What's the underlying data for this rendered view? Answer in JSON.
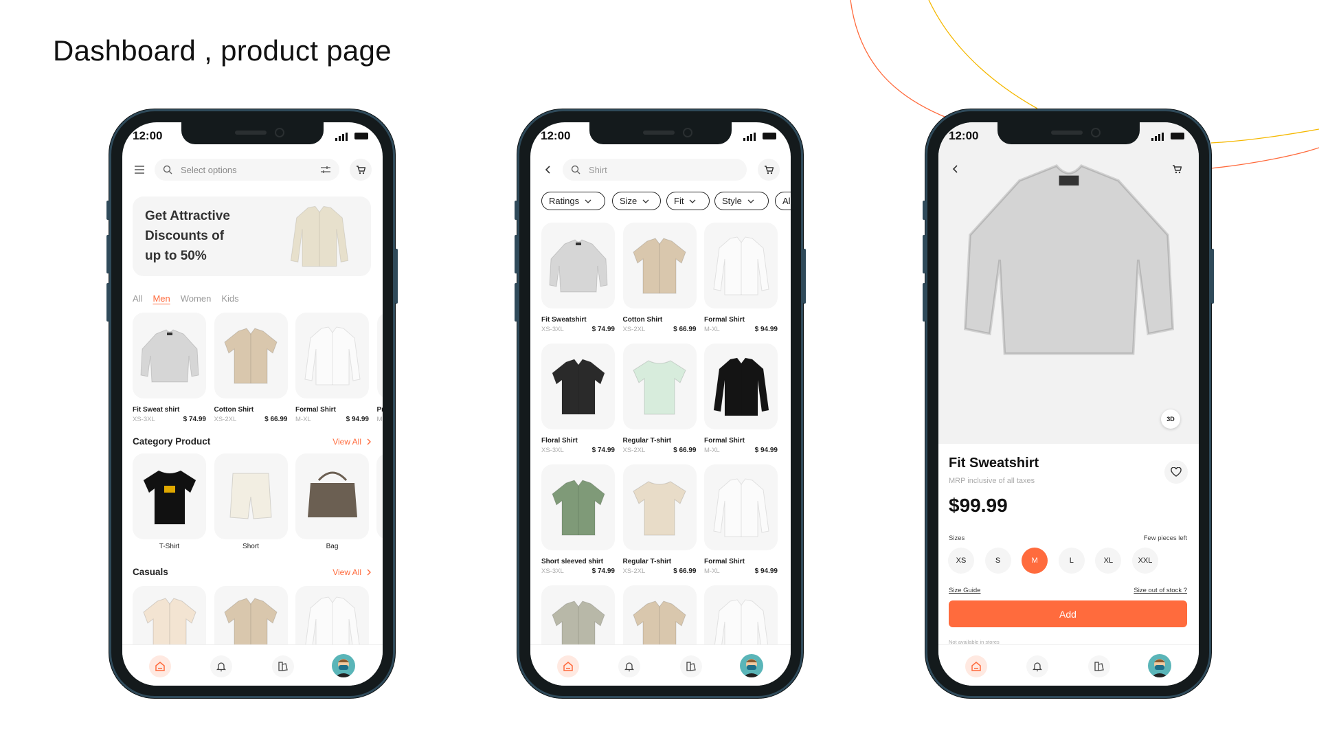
{
  "page_title": "Dashboard , product page",
  "accent": "#ff6b3d",
  "status_time": "12:00",
  "dashboard": {
    "search_placeholder": "Select options",
    "banner": [
      "Get Attractive",
      "Discounts of",
      "up to 50%"
    ],
    "tabs": [
      {
        "label": "All"
      },
      {
        "label": "Men",
        "active": true
      },
      {
        "label": "Women"
      },
      {
        "label": "Kids"
      }
    ],
    "products": [
      {
        "name": "Fit Sweat shirt",
        "sizes": "XS-3XL",
        "price": "$ 74.99",
        "image": "sweatshirt",
        "color": "#d6d6d6"
      },
      {
        "name": "Cotton Shirt",
        "sizes": "XS-2XL",
        "price": "$ 66.99",
        "image": "shirt",
        "color": "#d9c7ad"
      },
      {
        "name": "Formal Shirt",
        "sizes": "M-XL",
        "price": "$ 94.99",
        "image": "longshirt",
        "color": "#fbfbfb"
      },
      {
        "name": "Pr",
        "sizes": "M",
        "price": "",
        "image": "none",
        "color": "#f6f6f6"
      }
    ],
    "category_title": "Category Product",
    "view_all": "View All",
    "categories": [
      {
        "label": "T-Shirt",
        "image": "tshirt",
        "color": "#111111"
      },
      {
        "label": "Short",
        "image": "shorts",
        "color": "#f2eee2"
      },
      {
        "label": "Bag",
        "image": "bag",
        "color": "#6b5f52"
      }
    ],
    "casuals_title": "Casuals",
    "casuals": [
      {
        "image": "shirt",
        "color": "#f3e4d2"
      },
      {
        "image": "shirt",
        "color": "#d9c7ad"
      },
      {
        "image": "longshirt",
        "color": "#fbfbfb"
      }
    ]
  },
  "search": {
    "query": "Shirt",
    "filters": [
      "Ratings",
      "Size",
      "Fit",
      "Style",
      "All"
    ],
    "results": [
      {
        "name": "Fit Sweatshirt",
        "sizes": "XS-3XL",
        "price": "$ 74.99",
        "image": "sweatshirt",
        "color": "#d6d6d6"
      },
      {
        "name": "Cotton Shirt",
        "sizes": "XS-2XL",
        "price": "$ 66.99",
        "image": "shirt",
        "color": "#d9c7ad"
      },
      {
        "name": "Formal Shirt",
        "sizes": "M-XL",
        "price": "$ 94.99",
        "image": "longshirt",
        "color": "#fbfbfb"
      },
      {
        "name": "Floral Shirt",
        "sizes": "XS-3XL",
        "price": "$ 74.99",
        "image": "shirt",
        "color": "#2a2a2a"
      },
      {
        "name": "Regular T-shirt",
        "sizes": "XS-2XL",
        "price": "$ 66.99",
        "image": "tshirt",
        "color": "#d7ecdc"
      },
      {
        "name": "Formal Shirt",
        "sizes": "M-XL",
        "price": "$ 94.99",
        "image": "longshirt",
        "color": "#141414"
      },
      {
        "name": "Short sleeved shirt",
        "sizes": "XS-3XL",
        "price": "$ 74.99",
        "image": "shirt",
        "color": "#7f9a78"
      },
      {
        "name": "Regular T-shirt",
        "sizes": "XS-2XL",
        "price": "$ 66.99",
        "image": "tshirt",
        "color": "#e8dcc8"
      },
      {
        "name": "Formal Shirt",
        "sizes": "M-XL",
        "price": "$ 94.99",
        "image": "longshirt",
        "color": "#fbfbfb"
      },
      {
        "name": "",
        "sizes": "",
        "price": "",
        "image": "shirt",
        "color": "#b8b8a8"
      },
      {
        "name": "",
        "sizes": "",
        "price": "",
        "image": "shirt",
        "color": "#d9c7ad"
      },
      {
        "name": "",
        "sizes": "",
        "price": "",
        "image": "longshirt",
        "color": "#fbfbfb"
      }
    ]
  },
  "detail": {
    "badge": "3D",
    "title": "Fit Sweatshirt",
    "subtitle": "MRP inclusive of all taxes",
    "price": "$99.99",
    "sizes_label": "Sizes",
    "stock_note": "Few pieces left",
    "sizes": [
      "XS",
      "S",
      "M",
      "L",
      "XL",
      "XXL"
    ],
    "selected_size": "M",
    "size_guide": "Size Guide",
    "size_out": "Size out of stock ?",
    "add_label": "Add",
    "store_note": "Not available in stores",
    "image": "sweatshirt",
    "color": "#d4d4d4"
  }
}
